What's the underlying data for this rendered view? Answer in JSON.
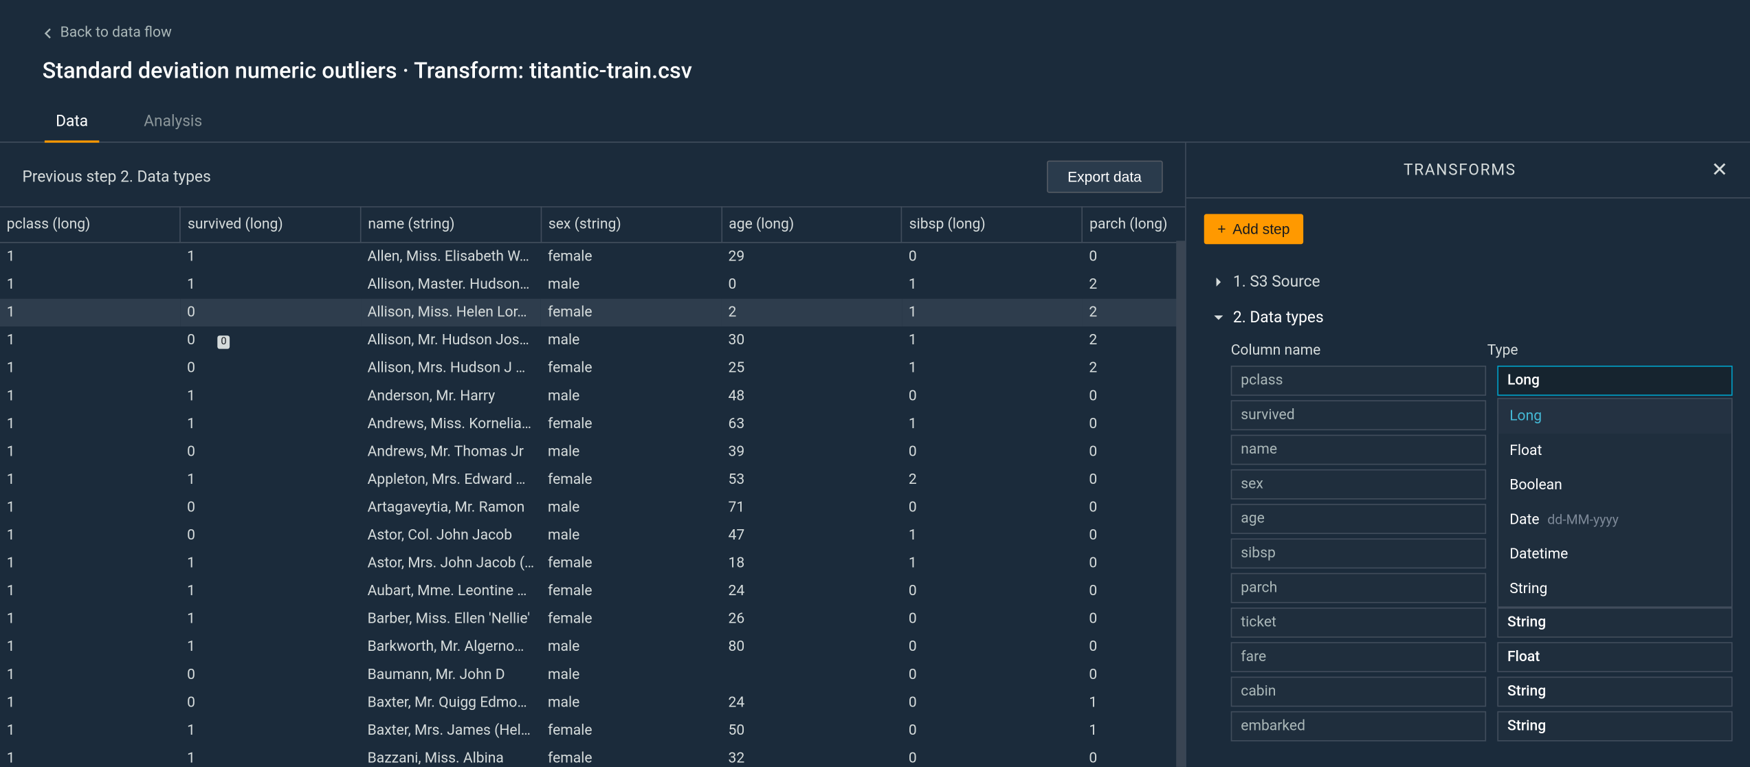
{
  "header": {
    "back_label": "Back to data flow",
    "title": "Standard deviation numeric outliers · Transform: titantic-train.csv"
  },
  "tabs": [
    {
      "label": "Data",
      "active": true
    },
    {
      "label": "Analysis",
      "active": false
    }
  ],
  "subheader": {
    "previous_step": "Previous step 2. Data types",
    "export_label": "Export data"
  },
  "table": {
    "columns": [
      "pclass (long)",
      "survived (long)",
      "name (string)",
      "sex (string)",
      "age (long)",
      "sibsp (long)",
      "parch (long)"
    ],
    "rows": [
      [
        "1",
        "1",
        "Allen, Miss. Elisabeth W…",
        "female",
        "29",
        "0",
        "0"
      ],
      [
        "1",
        "1",
        "Allison, Master. Hudson…",
        "male",
        "0",
        "1",
        "2"
      ],
      [
        "1",
        "0",
        "Allison, Miss. Helen Lor…",
        "female",
        "2",
        "1",
        "2"
      ],
      [
        "1",
        "0",
        "Allison, Mr. Hudson Jos…",
        "male",
        "30",
        "1",
        "2"
      ],
      [
        "1",
        "0",
        "Allison, Mrs. Hudson J C…",
        "female",
        "25",
        "1",
        "2"
      ],
      [
        "1",
        "1",
        "Anderson, Mr. Harry",
        "male",
        "48",
        "0",
        "0"
      ],
      [
        "1",
        "1",
        "Andrews, Miss. Kornelia…",
        "female",
        "63",
        "1",
        "0"
      ],
      [
        "1",
        "0",
        "Andrews, Mr. Thomas Jr",
        "male",
        "39",
        "0",
        "0"
      ],
      [
        "1",
        "1",
        "Appleton, Mrs. Edward …",
        "female",
        "53",
        "2",
        "0"
      ],
      [
        "1",
        "0",
        "Artagaveytia, Mr. Ramon",
        "male",
        "71",
        "0",
        "0"
      ],
      [
        "1",
        "0",
        "Astor, Col. John Jacob",
        "male",
        "47",
        "1",
        "0"
      ],
      [
        "1",
        "1",
        "Astor, Mrs. John Jacob (…",
        "female",
        "18",
        "1",
        "0"
      ],
      [
        "1",
        "1",
        "Aubart, Mme. Leontine …",
        "female",
        "24",
        "0",
        "0"
      ],
      [
        "1",
        "1",
        "Barber, Miss. Ellen 'Nellie'",
        "female",
        "26",
        "0",
        "0"
      ],
      [
        "1",
        "1",
        "Barkworth, Mr. Algerno…",
        "male",
        "80",
        "0",
        "0"
      ],
      [
        "1",
        "0",
        "Baumann, Mr. John D",
        "male",
        "",
        "0",
        "0"
      ],
      [
        "1",
        "0",
        "Baxter, Mr. Quigg Edmo…",
        "male",
        "24",
        "0",
        "1"
      ],
      [
        "1",
        "1",
        "Baxter, Mrs. James (Hel…",
        "female",
        "50",
        "0",
        "1"
      ],
      [
        "1",
        "1",
        "Bazzani, Miss. Albina",
        "female",
        "32",
        "0",
        "0"
      ]
    ],
    "selected_row": 2,
    "badge_row": 3,
    "badge_value": "0"
  },
  "transforms_panel": {
    "title": "TRANSFORMS",
    "add_step_label": "Add step",
    "steps": [
      {
        "label": "1. S3 Source",
        "expanded": false
      },
      {
        "label": "2. Data types",
        "expanded": true
      }
    ],
    "field_headers": {
      "name": "Column name",
      "type": "Type"
    },
    "fields": [
      {
        "name": "pclass",
        "type": "Long",
        "dropdown_open": true
      },
      {
        "name": "survived",
        "type": ""
      },
      {
        "name": "name",
        "type": ""
      },
      {
        "name": "sex",
        "type": ""
      },
      {
        "name": "age",
        "type": ""
      },
      {
        "name": "sibsp",
        "type": ""
      },
      {
        "name": "parch",
        "type": ""
      },
      {
        "name": "ticket",
        "type": "String"
      },
      {
        "name": "fare",
        "type": "Float"
      },
      {
        "name": "cabin",
        "type": "String"
      },
      {
        "name": "embarked",
        "type": "String"
      }
    ],
    "dropdown_options": [
      {
        "label": "Long",
        "selected": true
      },
      {
        "label": "Float"
      },
      {
        "label": "Boolean"
      },
      {
        "label": "Date",
        "hint": "dd-MM-yyyy"
      },
      {
        "label": "Datetime"
      },
      {
        "label": "String"
      }
    ]
  }
}
